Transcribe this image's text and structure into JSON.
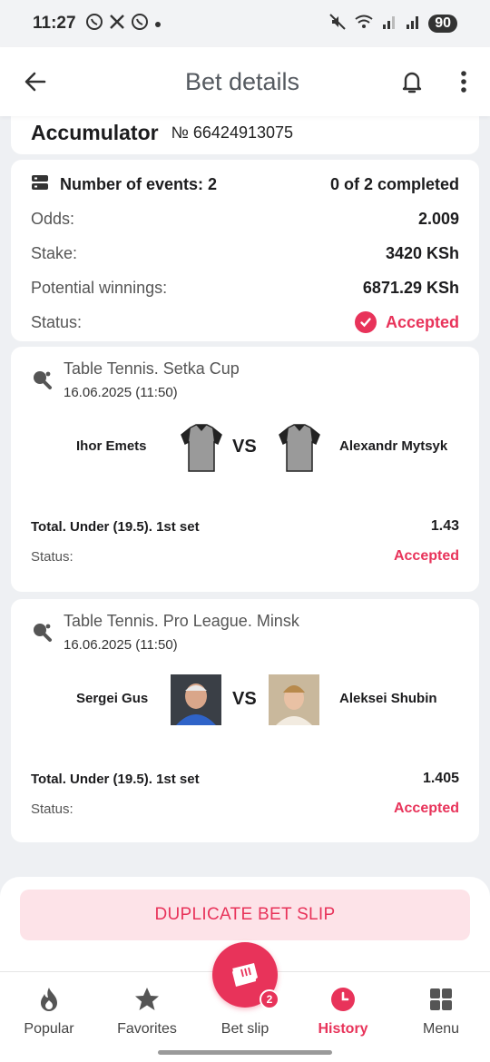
{
  "status_bar": {
    "time": "11:27",
    "battery": "90"
  },
  "header": {
    "title": "Bet details"
  },
  "bet": {
    "type": "Accumulator",
    "number": "№ 66424913075",
    "events_label": "Number of events: 2",
    "completed": "0 of 2 completed",
    "odds_label": "Odds:",
    "odds_value": "2.009",
    "stake_label": "Stake:",
    "stake_value": "3420 KSh",
    "winnings_label": "Potential winnings:",
    "winnings_value": "6871.29 KSh",
    "status_label": "Status:",
    "status_value": "Accepted"
  },
  "events": [
    {
      "league": "Table Tennis. Setka Cup",
      "date": "16.06.2025 (11:50)",
      "team1": "Ihor Emets",
      "team2": "Alexandr Mytsyk",
      "vs": "VS",
      "market": "Total. Under (19.5). 1st set",
      "odd": "1.43",
      "status_label": "Status:",
      "status_value": "Accepted"
    },
    {
      "league": "Table Tennis. Pro League. Minsk",
      "date": "16.06.2025 (11:50)",
      "team1": "Sergei Gus",
      "team2": "Aleksei Shubin",
      "vs": "VS",
      "market": "Total. Under (19.5). 1st set",
      "odd": "1.405",
      "status_label": "Status:",
      "status_value": "Accepted"
    }
  ],
  "actions": {
    "duplicate": "DUPLICATE BET SLIP"
  },
  "nav": {
    "popular": "Popular",
    "favorites": "Favorites",
    "betslip": "Bet slip",
    "betslip_badge": "2",
    "history": "History",
    "menu": "Menu"
  },
  "colors": {
    "accent": "#e8335a",
    "accent_light": "#fde3e8"
  }
}
